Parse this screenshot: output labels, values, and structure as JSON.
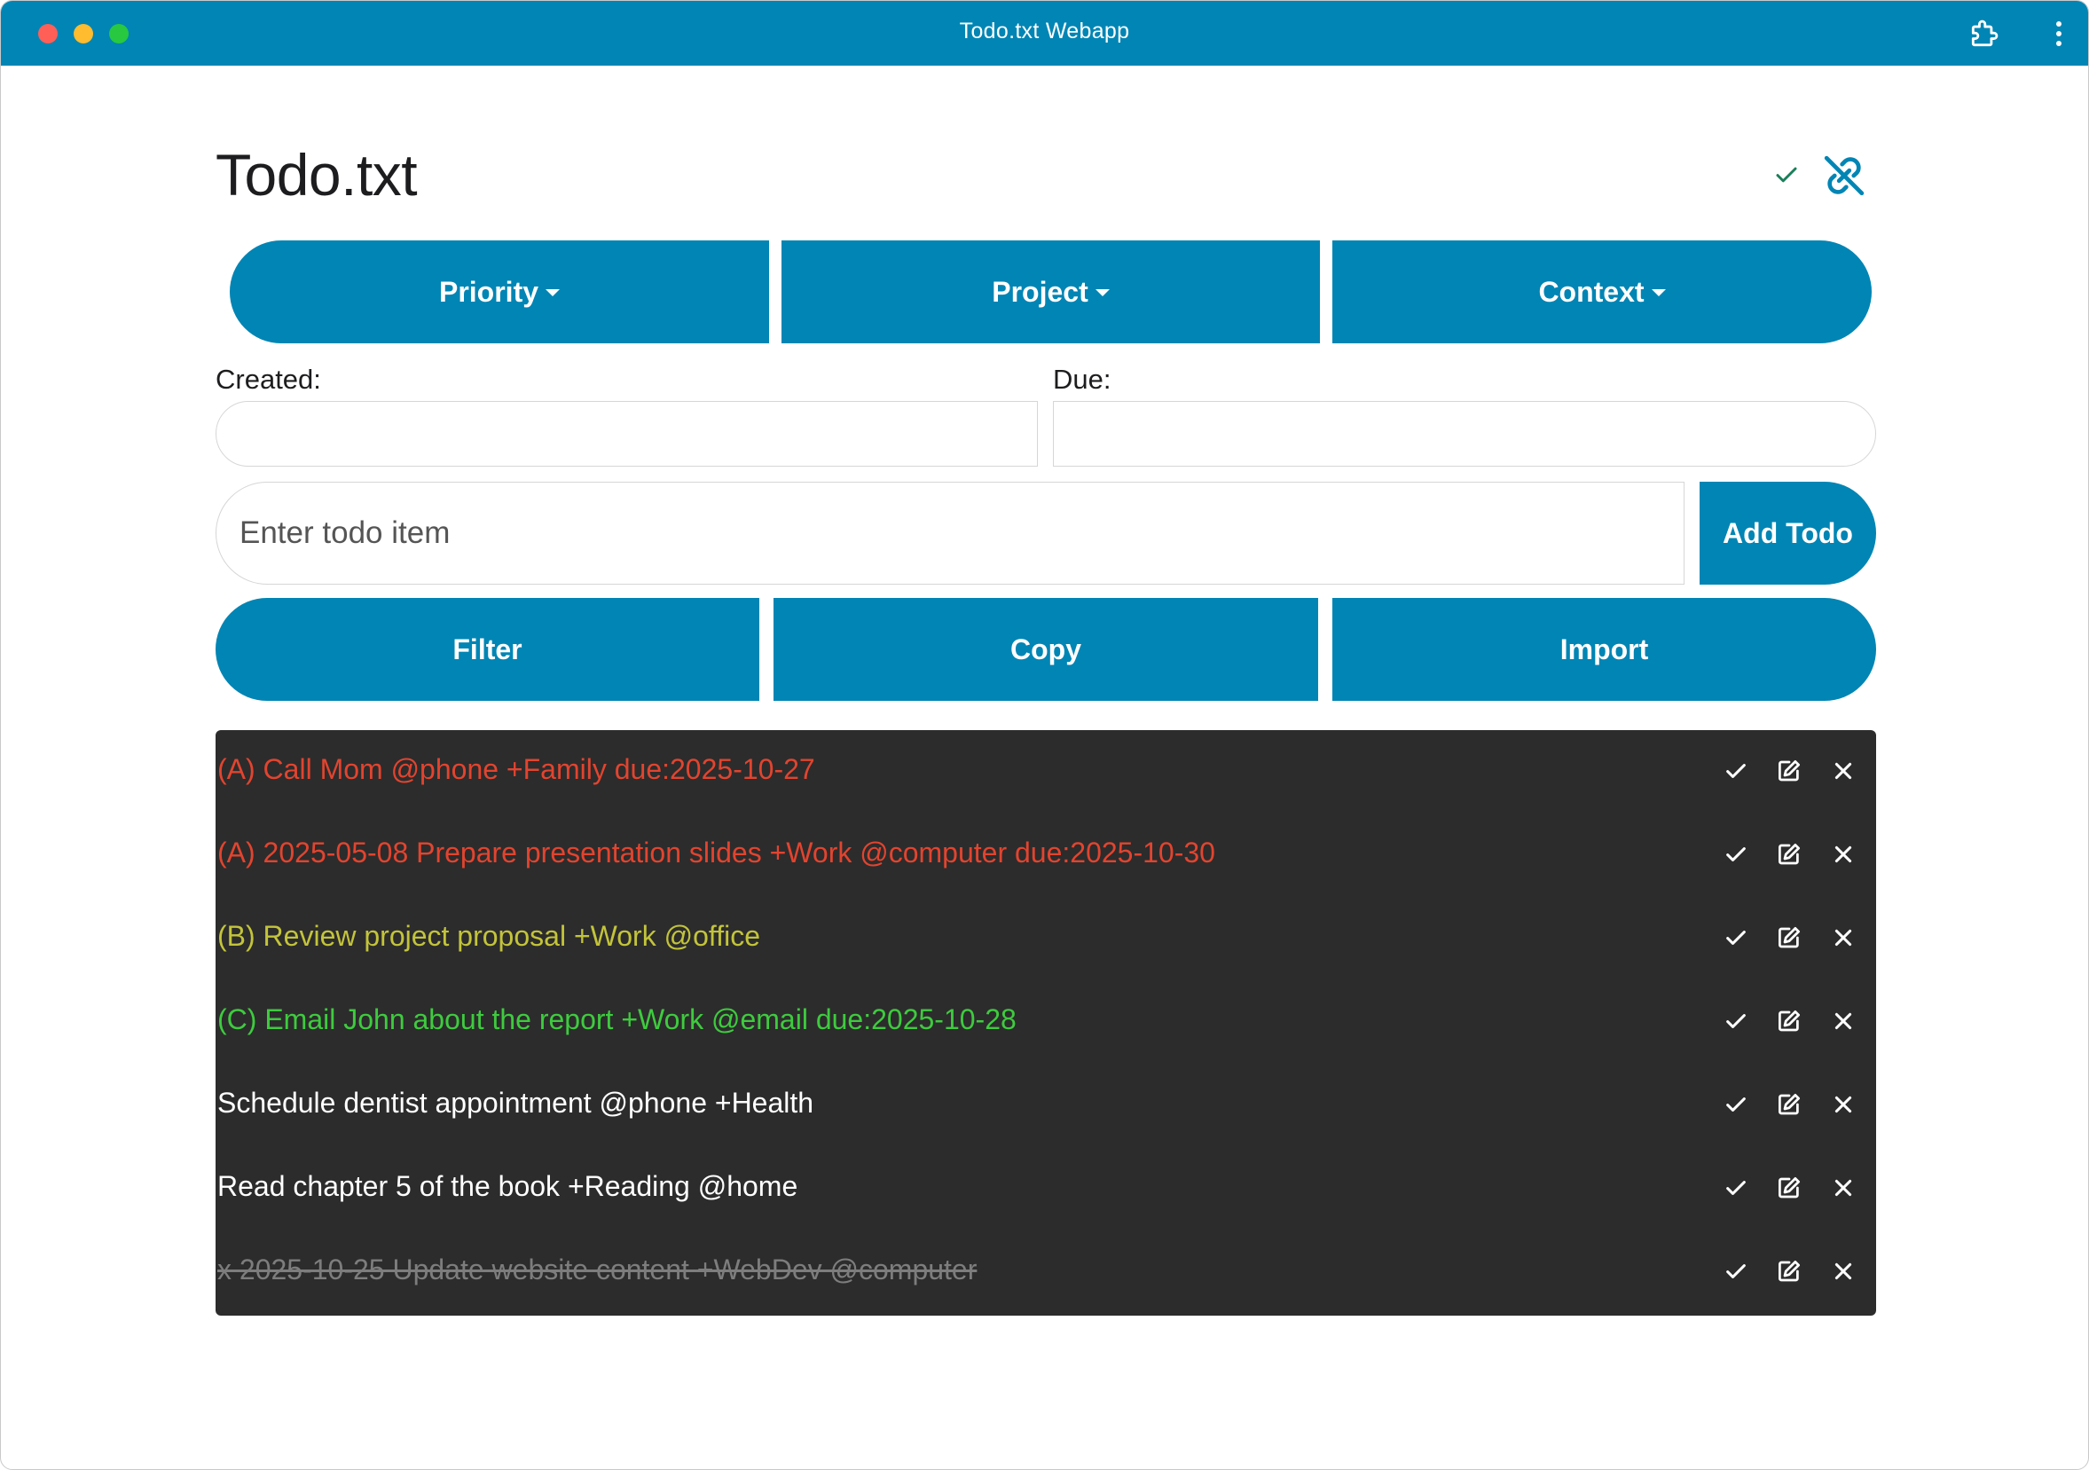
{
  "window": {
    "title": "Todo.txt Webapp"
  },
  "app": {
    "title": "Todo.txt"
  },
  "toolbar": {
    "priority_label": "Priority",
    "project_label": "Project",
    "context_label": "Context"
  },
  "dates": {
    "created_label": "Created:",
    "created_value": "",
    "due_label": "Due:",
    "due_value": ""
  },
  "entry": {
    "placeholder": "Enter todo item",
    "value": "",
    "add_label": "Add Todo"
  },
  "actions": {
    "filter_label": "Filter",
    "copy_label": "Copy",
    "import_label": "Import"
  },
  "todos": [
    {
      "text": "(A) Call Mom @phone +Family due:2025-10-27",
      "color": "#e2442f",
      "completed": false
    },
    {
      "text": "(A) 2025-05-08 Prepare presentation slides +Work @computer due:2025-10-30",
      "color": "#e2442f",
      "completed": false
    },
    {
      "text": "(B) Review project proposal +Work @office",
      "color": "#c3c43a",
      "completed": false
    },
    {
      "text": "(C) Email John about the report +Work @email due:2025-10-28",
      "color": "#3ecb3e",
      "completed": false
    },
    {
      "text": "Schedule dentist appointment @phone +Health",
      "color": "#ffffff",
      "completed": false
    },
    {
      "text": "Read chapter 5 of the book +Reading @home",
      "color": "#ffffff",
      "completed": false
    },
    {
      "text": "x 2025-10-25 Update website content +WebDev @computer",
      "color": "#7d7d7d",
      "completed": true
    }
  ],
  "icons": {
    "item_done": "check-icon",
    "item_edit": "edit-icon",
    "item_delete": "close-icon",
    "sync_status": "check-icon",
    "sync_link": "unlink-icon"
  },
  "colors": {
    "accent": "#0085b4",
    "list_bg": "#2c2c2c",
    "priority_a": "#e2442f",
    "priority_b": "#c3c43a",
    "priority_c": "#3ecb3e",
    "completed": "#7d7d7d",
    "status_ok": "#1a7f5a"
  }
}
